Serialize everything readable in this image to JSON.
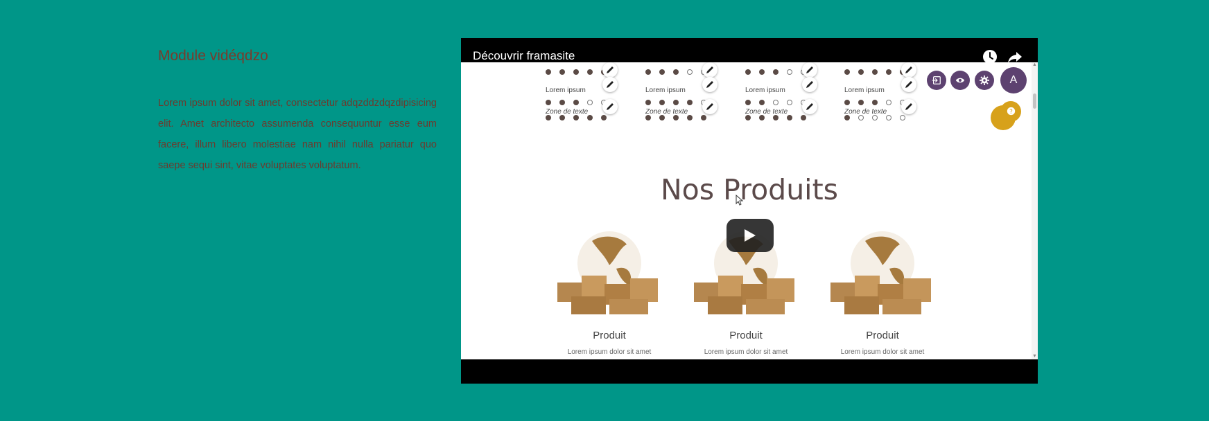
{
  "module": {
    "title": "Module vidéqdzo",
    "description": "Lorem ipsum dolor sit amet, consectetur adqzddzdqzdipisicing elit. Amet architecto assumenda consequuntur esse eum facere, illum libero molestiae nam nihil nulla pariatur quo saepe sequi sint, vitae voluptates voluptatum."
  },
  "video": {
    "title": "Découvrir framasite",
    "watch_later_icon": "clock-icon",
    "share_icon": "share-icon",
    "play_icon": "play-icon"
  },
  "preview": {
    "rating_columns": [
      {
        "label": "Lorem ipsum",
        "zone_label": "Zone de texte",
        "row1": [
          1,
          1,
          1,
          1,
          1
        ],
        "row2": [
          1,
          1,
          1,
          0,
          0
        ],
        "row3": [
          1,
          1,
          1,
          1,
          1
        ]
      },
      {
        "label": "Lorem ipsum",
        "zone_label": "Zone de texte",
        "row1": [
          1,
          1,
          1,
          0,
          0
        ],
        "row2": [
          1,
          1,
          1,
          1,
          0
        ],
        "row3": [
          1,
          1,
          1,
          1,
          1
        ]
      },
      {
        "label": "Lorem ipsum",
        "zone_label": "Zone de texte",
        "row1": [
          1,
          1,
          1,
          0,
          0
        ],
        "row2": [
          1,
          1,
          0,
          0,
          0
        ],
        "row3": [
          1,
          1,
          1,
          1,
          1
        ]
      },
      {
        "label": "Lorem ipsum",
        "zone_label": "Zone de texte",
        "row1": [
          1,
          1,
          1,
          1,
          1
        ],
        "row2": [
          1,
          1,
          1,
          0,
          0
        ],
        "row3": [
          1,
          0,
          0,
          0,
          0
        ]
      }
    ],
    "toolbar_icons": [
      "login-icon",
      "eye-icon",
      "gear-icon"
    ],
    "avatar_letter": "A",
    "help_icon": "question-icon",
    "products_title": "Nos Produits",
    "products": [
      {
        "name": "Produit",
        "desc": "Lorem ipsum dolor sit amet"
      },
      {
        "name": "Produit",
        "desc": "Lorem ipsum dolor sit amet"
      },
      {
        "name": "Produit",
        "desc": "Lorem ipsum dolor sit amet"
      }
    ]
  },
  "colors": {
    "background": "#009688",
    "title_text": "#7a3b2c",
    "fab_purple": "#5d4270",
    "help_gold": "#d7a11b"
  }
}
